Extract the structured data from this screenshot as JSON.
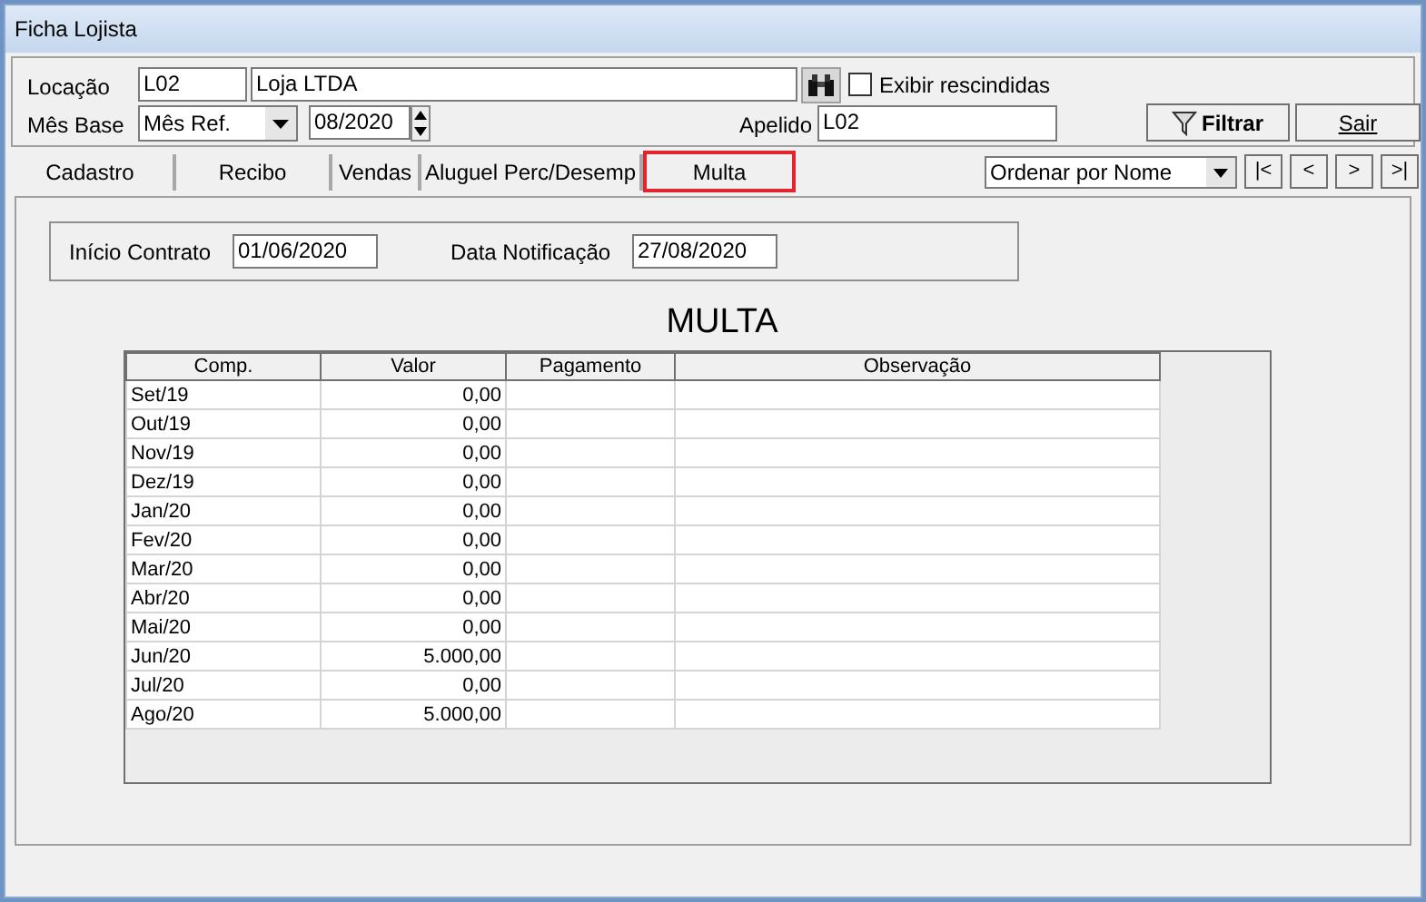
{
  "window": {
    "title": "Ficha Lojista"
  },
  "header": {
    "locacao_label": "Locação",
    "locacao_code": "L02",
    "locacao_name": "Loja LTDA",
    "exibir_rescindidas": {
      "label": "Exibir rescindidas",
      "checked": false
    },
    "mes_base_label": "Mês Base",
    "mes_base_select": "Mês Ref.",
    "mes_base_value": "08/2020",
    "apelido_label": "Apelido",
    "apelido_value": "L02",
    "filtrar_button": "Filtrar",
    "sair_button": "Sair"
  },
  "tabs": [
    {
      "label": "Cadastro",
      "selected": false
    },
    {
      "label": "Recibo",
      "selected": false
    },
    {
      "label": "Vendas",
      "selected": false
    },
    {
      "label": "Aluguel Perc/Desemp",
      "selected": false
    },
    {
      "label": "Multa",
      "selected": true
    }
  ],
  "sort_select": "Ordenar por Nome",
  "nav_buttons": [
    "|<",
    "<",
    ">",
    ">|"
  ],
  "contract": {
    "inicio_label": "Início Contrato",
    "inicio_value": "01/06/2020",
    "notificacao_label": "Data Notificação",
    "notificacao_value": "27/08/2020"
  },
  "section_title": "MULTA",
  "table": {
    "columns": [
      "Comp.",
      "Valor",
      "Pagamento",
      "Observação"
    ],
    "rows": [
      [
        "Set/19",
        "0,00"
      ],
      [
        "Out/19",
        "0,00"
      ],
      [
        "Nov/19",
        "0,00"
      ],
      [
        "Dez/19",
        "0,00"
      ],
      [
        "Jan/20",
        "0,00"
      ],
      [
        "Fev/20",
        "0,00"
      ],
      [
        "Mar/20",
        "0,00"
      ],
      [
        "Abr/20",
        "0,00"
      ],
      [
        "Mai/20",
        "0,00"
      ],
      [
        "Jun/20",
        "5.000,00"
      ],
      [
        "Jul/20",
        "0,00"
      ],
      [
        "Ago/20",
        "5.000,00"
      ]
    ]
  }
}
